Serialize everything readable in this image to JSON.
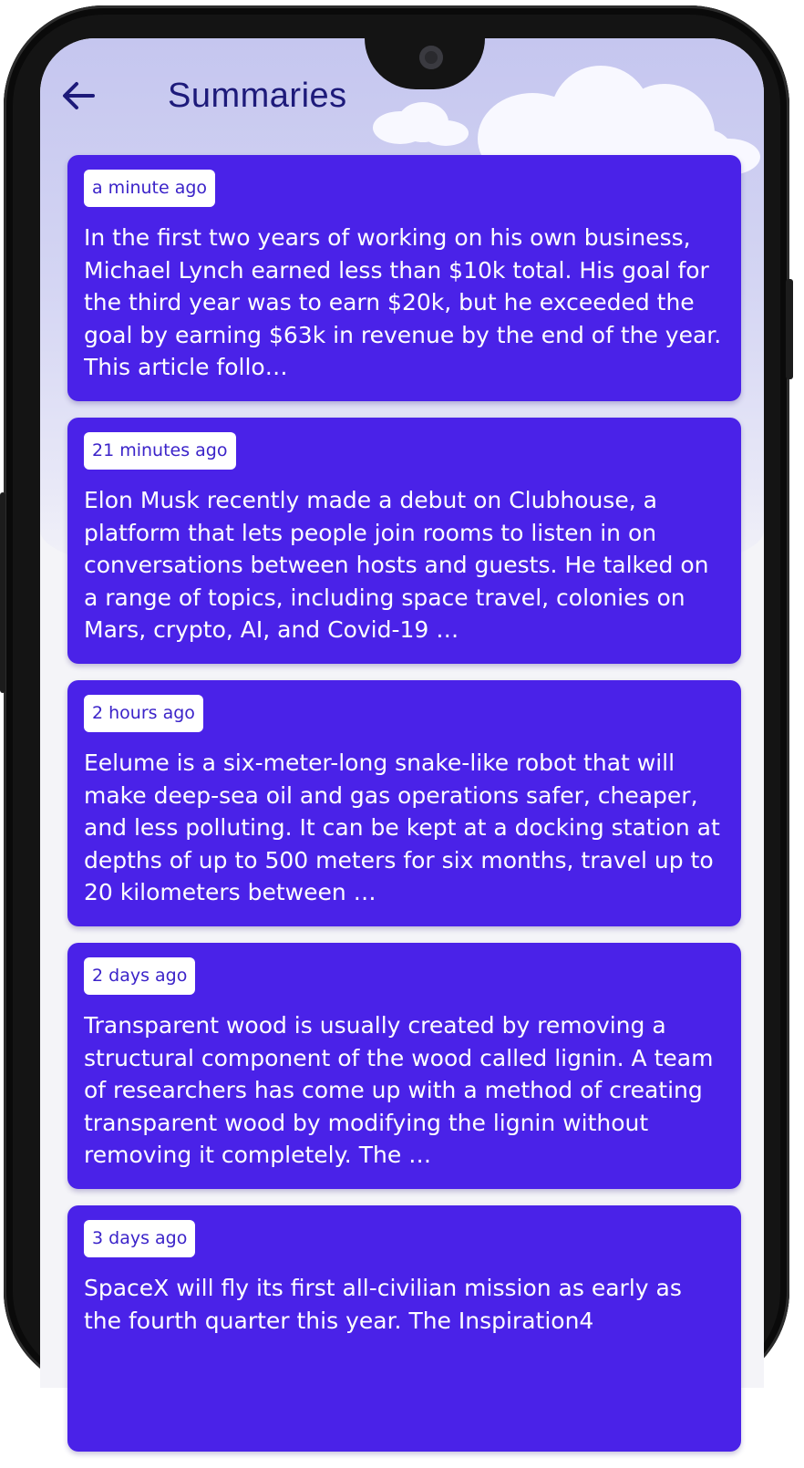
{
  "header": {
    "back_icon": "arrow-left-icon",
    "title": "Summaries"
  },
  "colors": {
    "card": "#4a22e8",
    "header_text": "#1d1a7a",
    "badge_text": "#3b23c9"
  },
  "summaries": [
    {
      "time": "a minute ago",
      "text": "In the first two years of working on his own business, Michael Lynch earned less than $10k total. His goal for the third year was to earn $20k, but he exceeded the goal by earning $63k in revenue by the end of the year. This article follo…"
    },
    {
      "time": "21 minutes ago",
      "text": "Elon Musk recently made a debut on Clubhouse, a platform that lets people join rooms to listen in on conversations between hosts and guests. He talked on a range of topics, including space travel, colonies on Mars, crypto, AI, and Covid-19 …"
    },
    {
      "time": "2 hours ago",
      "text": "Eelume is a six-meter-long snake-like robot that will make deep-sea oil and gas operations safer, cheaper, and less polluting. It can be kept at a docking station at depths of up to 500 meters for six months, travel up to 20 kilometers between …"
    },
    {
      "time": "2 days ago",
      "text": "Transparent wood is usually created by removing a structural component of the wood called lignin. A team of researchers has come up with a method of creating transparent wood by modifying the lignin without removing it completely. The …"
    },
    {
      "time": "3 days ago",
      "text": "SpaceX will fly its first all-civilian mission as early as the fourth quarter this year. The Inspiration4"
    }
  ]
}
